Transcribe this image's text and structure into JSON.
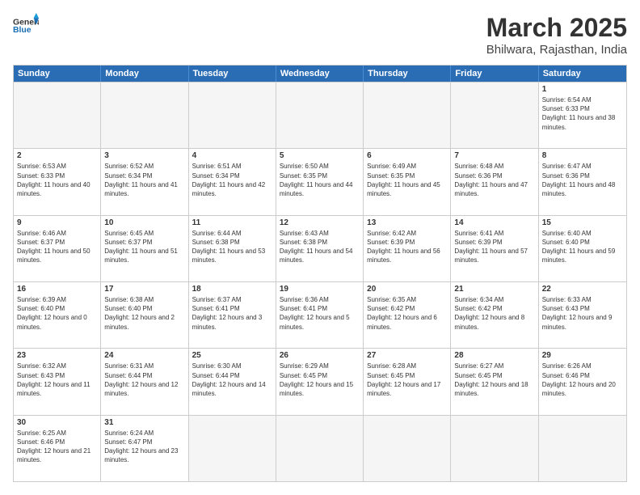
{
  "header": {
    "logo_general": "General",
    "logo_blue": "Blue",
    "title": "March 2025",
    "location": "Bhilwara, Rajasthan, India"
  },
  "days_of_week": [
    "Sunday",
    "Monday",
    "Tuesday",
    "Wednesday",
    "Thursday",
    "Friday",
    "Saturday"
  ],
  "weeks": [
    [
      {
        "day": "",
        "empty": true
      },
      {
        "day": "",
        "empty": true
      },
      {
        "day": "",
        "empty": true
      },
      {
        "day": "",
        "empty": true
      },
      {
        "day": "",
        "empty": true
      },
      {
        "day": "",
        "empty": true
      },
      {
        "day": "1",
        "sunrise": "6:54 AM",
        "sunset": "6:33 PM",
        "daylight": "11 hours and 38 minutes."
      }
    ],
    [
      {
        "day": "2",
        "sunrise": "6:53 AM",
        "sunset": "6:33 PM",
        "daylight": "11 hours and 40 minutes."
      },
      {
        "day": "3",
        "sunrise": "6:52 AM",
        "sunset": "6:34 PM",
        "daylight": "11 hours and 41 minutes."
      },
      {
        "day": "4",
        "sunrise": "6:51 AM",
        "sunset": "6:34 PM",
        "daylight": "11 hours and 42 minutes."
      },
      {
        "day": "5",
        "sunrise": "6:50 AM",
        "sunset": "6:35 PM",
        "daylight": "11 hours and 44 minutes."
      },
      {
        "day": "6",
        "sunrise": "6:49 AM",
        "sunset": "6:35 PM",
        "daylight": "11 hours and 45 minutes."
      },
      {
        "day": "7",
        "sunrise": "6:48 AM",
        "sunset": "6:36 PM",
        "daylight": "11 hours and 47 minutes."
      },
      {
        "day": "8",
        "sunrise": "6:47 AM",
        "sunset": "6:36 PM",
        "daylight": "11 hours and 48 minutes."
      }
    ],
    [
      {
        "day": "9",
        "sunrise": "6:46 AM",
        "sunset": "6:37 PM",
        "daylight": "11 hours and 50 minutes."
      },
      {
        "day": "10",
        "sunrise": "6:45 AM",
        "sunset": "6:37 PM",
        "daylight": "11 hours and 51 minutes."
      },
      {
        "day": "11",
        "sunrise": "6:44 AM",
        "sunset": "6:38 PM",
        "daylight": "11 hours and 53 minutes."
      },
      {
        "day": "12",
        "sunrise": "6:43 AM",
        "sunset": "6:38 PM",
        "daylight": "11 hours and 54 minutes."
      },
      {
        "day": "13",
        "sunrise": "6:42 AM",
        "sunset": "6:39 PM",
        "daylight": "11 hours and 56 minutes."
      },
      {
        "day": "14",
        "sunrise": "6:41 AM",
        "sunset": "6:39 PM",
        "daylight": "11 hours and 57 minutes."
      },
      {
        "day": "15",
        "sunrise": "6:40 AM",
        "sunset": "6:40 PM",
        "daylight": "11 hours and 59 minutes."
      }
    ],
    [
      {
        "day": "16",
        "sunrise": "6:39 AM",
        "sunset": "6:40 PM",
        "daylight": "12 hours and 0 minutes."
      },
      {
        "day": "17",
        "sunrise": "6:38 AM",
        "sunset": "6:40 PM",
        "daylight": "12 hours and 2 minutes."
      },
      {
        "day": "18",
        "sunrise": "6:37 AM",
        "sunset": "6:41 PM",
        "daylight": "12 hours and 3 minutes."
      },
      {
        "day": "19",
        "sunrise": "6:36 AM",
        "sunset": "6:41 PM",
        "daylight": "12 hours and 5 minutes."
      },
      {
        "day": "20",
        "sunrise": "6:35 AM",
        "sunset": "6:42 PM",
        "daylight": "12 hours and 6 minutes."
      },
      {
        "day": "21",
        "sunrise": "6:34 AM",
        "sunset": "6:42 PM",
        "daylight": "12 hours and 8 minutes."
      },
      {
        "day": "22",
        "sunrise": "6:33 AM",
        "sunset": "6:43 PM",
        "daylight": "12 hours and 9 minutes."
      }
    ],
    [
      {
        "day": "23",
        "sunrise": "6:32 AM",
        "sunset": "6:43 PM",
        "daylight": "12 hours and 11 minutes."
      },
      {
        "day": "24",
        "sunrise": "6:31 AM",
        "sunset": "6:44 PM",
        "daylight": "12 hours and 12 minutes."
      },
      {
        "day": "25",
        "sunrise": "6:30 AM",
        "sunset": "6:44 PM",
        "daylight": "12 hours and 14 minutes."
      },
      {
        "day": "26",
        "sunrise": "6:29 AM",
        "sunset": "6:45 PM",
        "daylight": "12 hours and 15 minutes."
      },
      {
        "day": "27",
        "sunrise": "6:28 AM",
        "sunset": "6:45 PM",
        "daylight": "12 hours and 17 minutes."
      },
      {
        "day": "28",
        "sunrise": "6:27 AM",
        "sunset": "6:45 PM",
        "daylight": "12 hours and 18 minutes."
      },
      {
        "day": "29",
        "sunrise": "6:26 AM",
        "sunset": "6:46 PM",
        "daylight": "12 hours and 20 minutes."
      }
    ],
    [
      {
        "day": "30",
        "sunrise": "6:25 AM",
        "sunset": "6:46 PM",
        "daylight": "12 hours and 21 minutes."
      },
      {
        "day": "31",
        "sunrise": "6:24 AM",
        "sunset": "6:47 PM",
        "daylight": "12 hours and 23 minutes."
      },
      {
        "day": "",
        "empty": true
      },
      {
        "day": "",
        "empty": true
      },
      {
        "day": "",
        "empty": true
      },
      {
        "day": "",
        "empty": true
      },
      {
        "day": "",
        "empty": true
      }
    ]
  ]
}
